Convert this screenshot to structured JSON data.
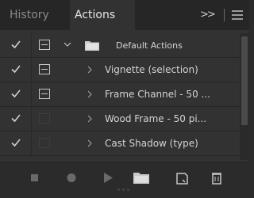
{
  "tabs": [
    {
      "label": "History"
    },
    {
      "label": "Actions"
    }
  ],
  "tab_menu": {
    "overflow_glyph": ">>"
  },
  "actions": [
    {
      "enabled": true,
      "dialog_toggle": true,
      "kind": "set",
      "expanded": true,
      "label": "Default Actions"
    },
    {
      "enabled": true,
      "dialog_toggle": true,
      "kind": "action",
      "expanded": false,
      "label": "Vignette (selection)"
    },
    {
      "enabled": true,
      "dialog_toggle": true,
      "kind": "action",
      "expanded": false,
      "label": "Frame Channel - 50 ..."
    },
    {
      "enabled": true,
      "dialog_toggle": false,
      "kind": "action",
      "expanded": false,
      "label": "Wood Frame - 50 pi..."
    },
    {
      "enabled": true,
      "dialog_toggle": false,
      "kind": "action",
      "expanded": false,
      "label": "Cast Shadow (type)"
    }
  ],
  "footer_buttons": [
    "stop-icon",
    "record-icon",
    "play-icon",
    "new-set-icon",
    "new-action-icon",
    "delete-icon"
  ],
  "colors": {
    "panel_bg": "#323232",
    "tabbar_bg": "#262626",
    "text": "#d4d4d4",
    "icon": "#cfcfcf",
    "disabled_icon": "#6a6a6a"
  }
}
